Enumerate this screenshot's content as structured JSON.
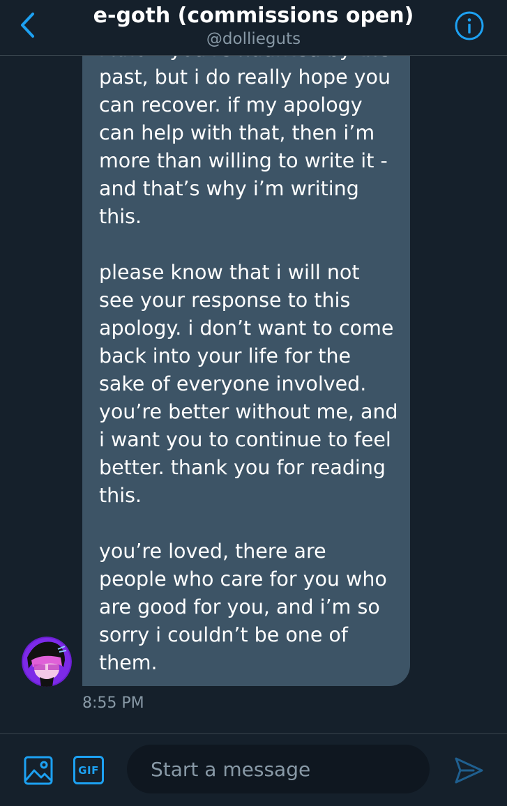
{
  "header": {
    "title": "e-goth (commissions open)",
    "handle": "@dollieguts",
    "back_icon": "chevron-left-icon",
    "info_icon": "info-icon"
  },
  "conversation": {
    "message": {
      "text": "i know you're haunted by the past, but i do really hope you can recover. if my apology can help with that, then i’m more than willing to write it - and that’s why i’m writing this.\n\nplease know that i will not see your response to this apology. i don’t want to come back into your life for the sake of everyone involved. you’re better without me, and i want you to continue to feel better. thank you for reading this.\n\nyou’re loved, there are people who care for you who are good for you, and i’m so sorry i couldn’t be one of them.",
      "timestamp": "8:55 PM"
    }
  },
  "composer": {
    "placeholder": "Start a message",
    "gif_label": "GIF",
    "media_icon": "image-icon",
    "send_icon": "send-icon"
  },
  "colors": {
    "background": "#15202b",
    "bubble": "#3d5466",
    "accent": "#1da1f2",
    "secondary_text": "#8899a6"
  }
}
